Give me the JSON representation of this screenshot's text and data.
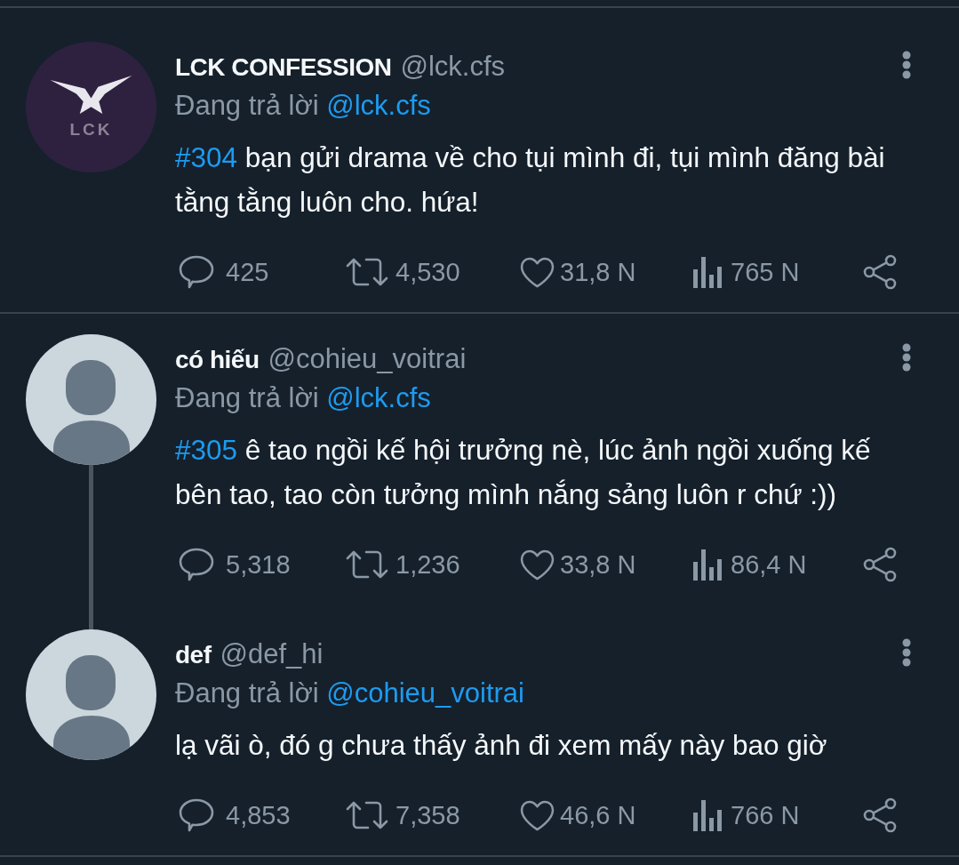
{
  "thread": [
    {
      "author": {
        "name": "LCK CONFESSION",
        "handle": "@lck.cfs"
      },
      "avatar": {
        "kind": "logo",
        "logo_text": "LCK"
      },
      "reply_label": "Đang trả lời",
      "reply_to": "@lck.cfs",
      "hashtag": "#304",
      "text": "bạn gửi drama về cho tụi mình đi, tụi mình đăng bài tằng tằng luôn cho. hứa!",
      "thread_line": false,
      "actions": [
        {
          "kind": "reply",
          "count": "425"
        },
        {
          "kind": "retweet",
          "count": "4,530"
        },
        {
          "kind": "like",
          "count": "31,8 N"
        },
        {
          "kind": "view",
          "count": "765 N"
        },
        {
          "kind": "share"
        }
      ]
    },
    {
      "author": {
        "name": "có hiếu",
        "handle": "@cohieu_voitrai"
      },
      "avatar": {
        "kind": "default"
      },
      "reply_label": "Đang trả lời",
      "reply_to": "@lck.cfs",
      "hashtag": "#305",
      "text": "ê tao ngồi kế hội trưởng nè, lúc ảnh ngồi xuống kế bên tao, tao còn tưởng mình nắng sảng luôn r chứ :))",
      "thread_line": true,
      "actions": [
        {
          "kind": "reply",
          "count": "5,318"
        },
        {
          "kind": "retweet",
          "count": "1,236"
        },
        {
          "kind": "like",
          "count": "33,8 N"
        },
        {
          "kind": "view",
          "count": "86,4 N"
        },
        {
          "kind": "share"
        }
      ]
    },
    {
      "author": {
        "name": "def",
        "handle": "@def_hi"
      },
      "avatar": {
        "kind": "default"
      },
      "reply_label": "Đang trả lời",
      "reply_to": "@cohieu_voitrai",
      "text": "lạ vãi ò, đó g chưa thấy ảnh đi xem mấy này bao giờ",
      "thread_line": false,
      "actions": [
        {
          "kind": "reply",
          "count": "4,853"
        },
        {
          "kind": "retweet",
          "count": "7,358"
        },
        {
          "kind": "like",
          "count": "46,6 N"
        },
        {
          "kind": "view",
          "count": "766 N"
        },
        {
          "kind": "share"
        }
      ]
    }
  ]
}
